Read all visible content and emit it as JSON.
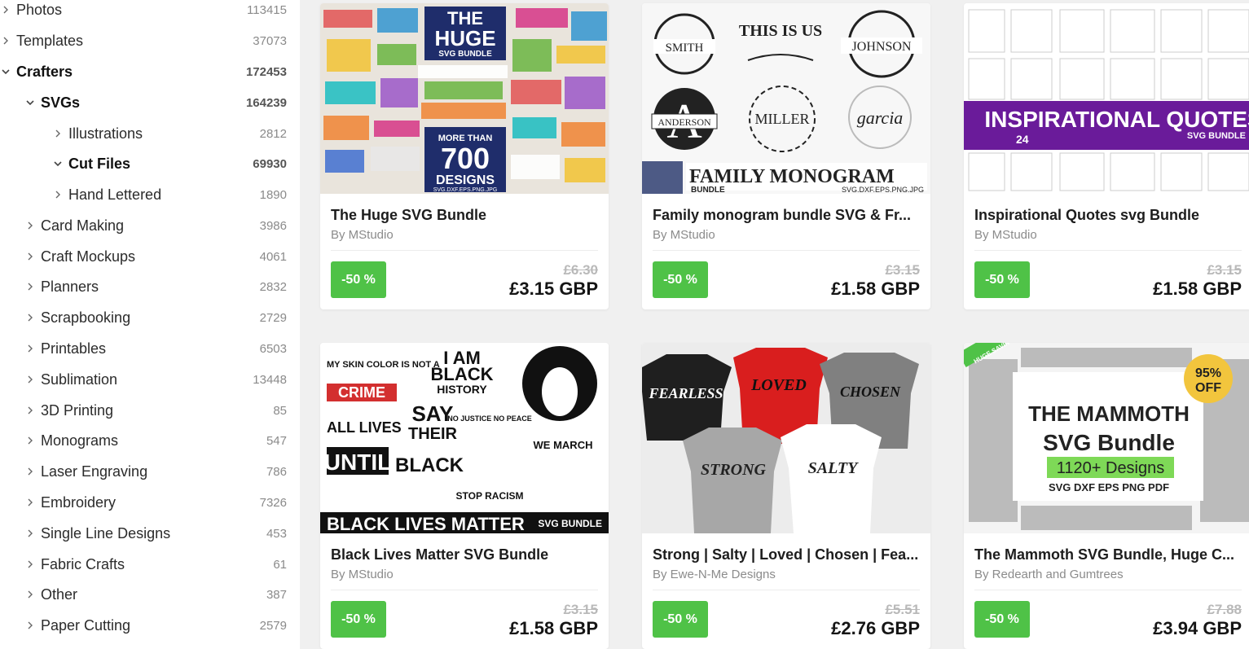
{
  "sidebar": {
    "items": [
      {
        "label": "Photos",
        "count": "113415"
      },
      {
        "label": "Templates",
        "count": "37073"
      },
      {
        "label": "Crafters",
        "count": "172453"
      },
      {
        "label": "SVGs",
        "count": "164239"
      },
      {
        "label": "Illustrations",
        "count": "2812"
      },
      {
        "label": "Cut Files",
        "count": "69930"
      },
      {
        "label": "Hand Lettered",
        "count": "1890"
      },
      {
        "label": "Card Making",
        "count": "3986"
      },
      {
        "label": "Craft Mockups",
        "count": "4061"
      },
      {
        "label": "Planners",
        "count": "2832"
      },
      {
        "label": "Scrapbooking",
        "count": "2729"
      },
      {
        "label": "Printables",
        "count": "6503"
      },
      {
        "label": "Sublimation",
        "count": "13448"
      },
      {
        "label": "3D Printing",
        "count": "85"
      },
      {
        "label": "Monograms",
        "count": "547"
      },
      {
        "label": "Laser Engraving",
        "count": "786"
      },
      {
        "label": "Embroidery",
        "count": "7326"
      },
      {
        "label": "Single Line Designs",
        "count": "453"
      },
      {
        "label": "Fabric Crafts",
        "count": "61"
      },
      {
        "label": "Other",
        "count": "387"
      },
      {
        "label": "Paper Cutting",
        "count": "2579"
      }
    ]
  },
  "products": [
    {
      "title": "The Huge SVG Bundle",
      "author": "By MStudio",
      "discount": "-50 %",
      "old_price": "£6.30",
      "price": "£3.15 GBP",
      "thumb": {
        "line1": "THE",
        "line2": "HUGE",
        "line3": "SVG BUNDLE",
        "line4": "MORE THAN",
        "line5": "700",
        "line6": "DESIGNS",
        "line7": "SVG.DXF.EPS.PNG.JPG"
      }
    },
    {
      "title": "Family monogram bundle SVG & Fr...",
      "author": "By MStudio",
      "discount": "-50 %",
      "old_price": "£3.15",
      "price": "£1.58 GBP",
      "thumb": {
        "n1": "SMITH",
        "n2": "THIS IS US",
        "n3": "JOHNSON",
        "n4": "ANDERSON",
        "n5": "MILLER",
        "n6": "garcia",
        "banner": "FAMILY MONOGRAM",
        "bundle": "BUNDLE",
        "formats": "SVG.DXF.EPS.PNG.JPG"
      }
    },
    {
      "title": "Inspirational Quotes svg Bundle",
      "author": "By MStudio",
      "discount": "-50 %",
      "old_price": "£3.15",
      "price": "£1.58 GBP",
      "thumb": {
        "banner": "INSPIRATIONAL QUOTES",
        "sub": "SVG BUNDLE",
        "listings": "24"
      }
    },
    {
      "title": "Black Lives Matter SVG Bundle",
      "author": "By MStudio",
      "discount": "-50 %",
      "old_price": "£3.15",
      "price": "£1.58 GBP",
      "thumb": {
        "q1": "MY SKIN COLOR IS NOT A",
        "q2": "CRIME",
        "q3": "I AM",
        "q4": "BLACK",
        "q5": "HISTORY",
        "q6": "SAY",
        "q7": "THEIR",
        "q8": "ALL LIVES",
        "q9": "UNTIL",
        "q10": "BLACK",
        "q11": "NO JUSTICE NO PEACE",
        "q12": "WE MARCH",
        "q13": "STOP RACISM",
        "banner": "BLACK LIVES MATTER",
        "sub": "SVG BUNDLE"
      }
    },
    {
      "title": "Strong | Salty | Loved | Chosen | Fea...",
      "author": "By Ewe-N-Me Designs",
      "discount": "-50 %",
      "old_price": "£5.51",
      "price": "£2.76 GBP",
      "thumb": {
        "s1": "FEARLESS",
        "s2": "LOVED",
        "s3": "CHOSEN",
        "s4": "STRONG",
        "s5": "SALTY"
      }
    },
    {
      "title": "The Mammoth SVG Bundle, Huge C...",
      "author": "By Redearth and Gumtrees",
      "discount": "-50 %",
      "old_price": "£7.88",
      "price": "£3.94 GBP",
      "thumb": {
        "badge1": "95%",
        "badge2": "OFF",
        "l1": "THE MAMMOTH",
        "l2": "SVG Bundle",
        "l3": "1120+ Designs",
        "l4": "SVG   DXF   EPS   PNG   PDF",
        "tag": "HUGE SAVINGS!"
      }
    }
  ],
  "colors": {
    "accent_green": "#4fc247",
    "quotes_purple": "#6a1b9a",
    "crime_red": "#d32f2f",
    "mammoth_green": "#7ed957"
  }
}
